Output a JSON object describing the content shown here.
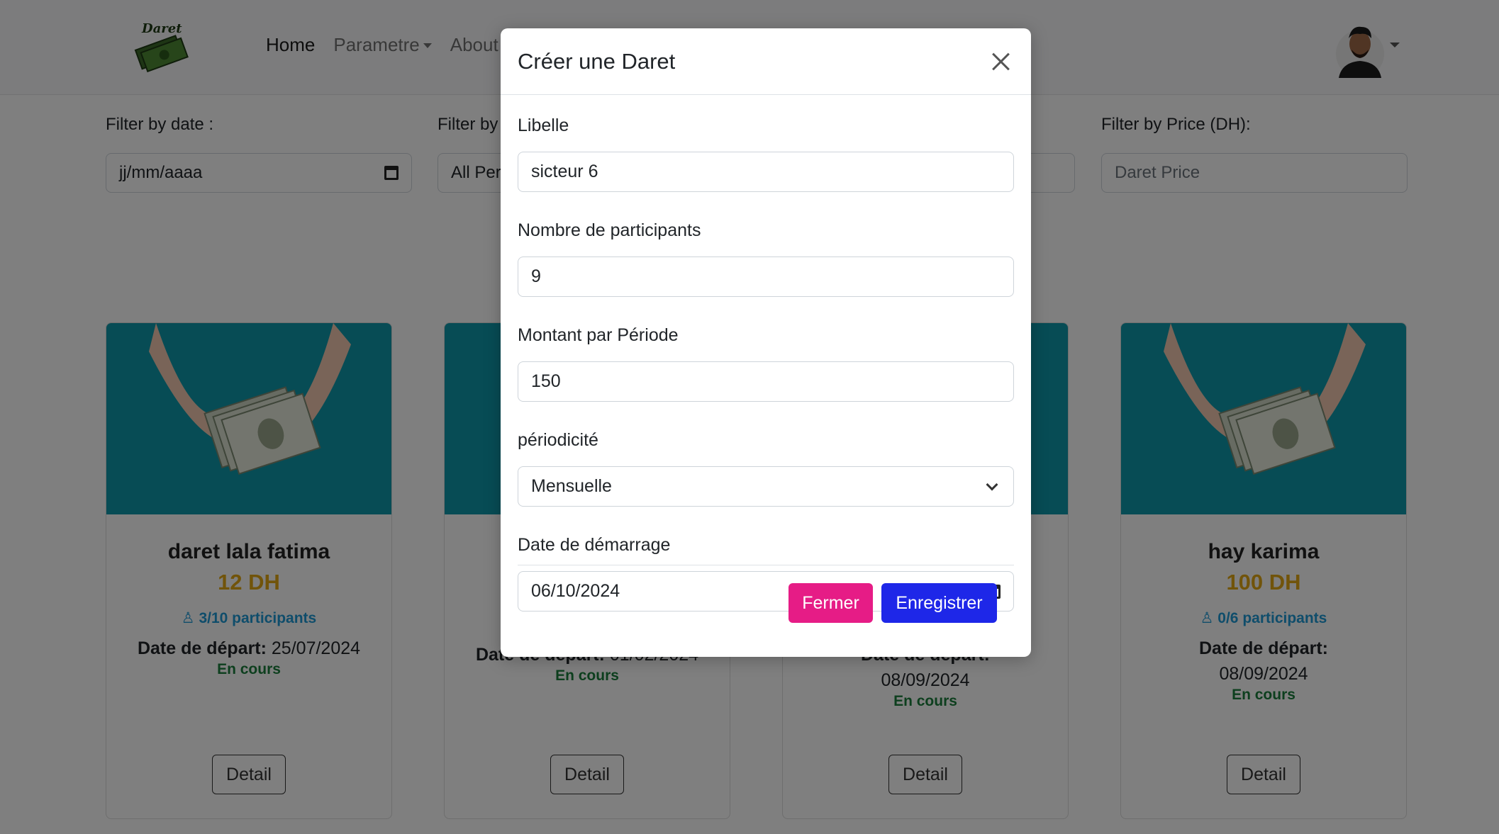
{
  "navbar": {
    "logo_text": "Daret",
    "links": [
      "Home",
      "Parametre",
      "About"
    ]
  },
  "filters": {
    "date": {
      "label": "Filter by date :",
      "value": "jj/mm/aaaa"
    },
    "period": {
      "label": "Filter by",
      "value": "All Per"
    },
    "price": {
      "label": "Filter by Price (DH):",
      "placeholder": "Daret Price"
    }
  },
  "cards": [
    {
      "title": "daret lala fatima",
      "price": "12 DH",
      "participants": "3/10 participants",
      "date_label": "Date de départ:",
      "date": "25/07/2024",
      "status": "En cours",
      "button": "Detail"
    },
    {
      "date_label": "Date de départ:",
      "date": "01/02/2024",
      "status": "En cours",
      "button": "Detail"
    },
    {
      "date_label": "Date de départ:",
      "date": "08/09/2024",
      "status": "En cours",
      "button": "Detail"
    },
    {
      "title": "hay karima",
      "price": "100 DH",
      "participants": "0/6 participants",
      "date_label": "Date de départ:",
      "date": "08/09/2024",
      "status": "En cours",
      "button": "Detail"
    }
  ],
  "modal": {
    "title": "Créer une Daret",
    "fields": {
      "libelle": {
        "label": "Libelle",
        "value": "sicteur 6"
      },
      "participants": {
        "label": "Nombre de participants",
        "value": "9"
      },
      "montant": {
        "label": "Montant par Période",
        "value": "150"
      },
      "periodicite": {
        "label": "périodicité",
        "value": "Mensuelle"
      },
      "date": {
        "label": "Date de démarrage",
        "value": "06/10/2024"
      }
    },
    "close_label": "Fermer",
    "save_label": "Enregistrer"
  },
  "colors": {
    "accent_pink": "#e61c86",
    "accent_blue": "#1e27e8",
    "price_gold": "#e3a815",
    "status_green": "#1b7f3c",
    "participants_blue": "#1f9ad6",
    "card_image_teal": "#0f98aa"
  }
}
